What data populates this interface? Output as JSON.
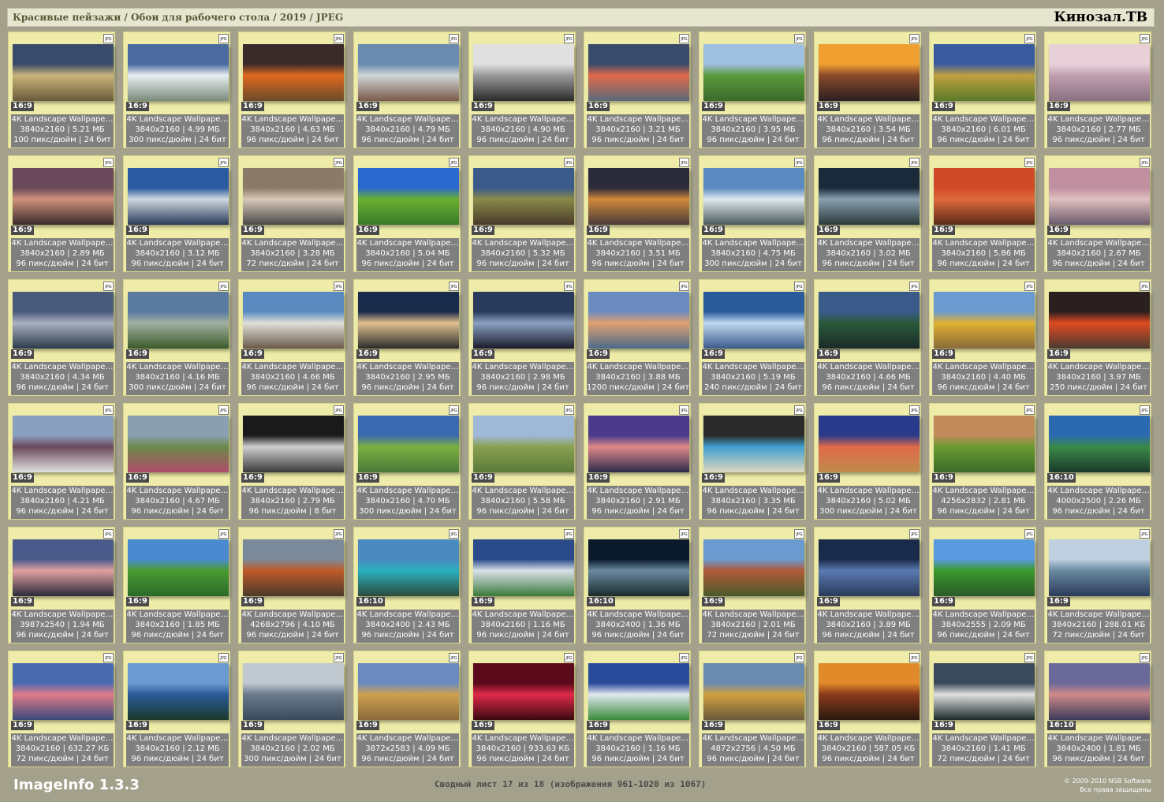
{
  "header": {
    "breadcrumb": "Красивые пейзажи / Обои для рабочего стола / 2019 / JPEG",
    "brand": "Кинозал.ТВ"
  },
  "footer": {
    "app_name": "ImageInfo 1.3.3",
    "summary": "Сводный лист 17 из 18 (изображения 961-1020 из 1067)",
    "copyright_line1": "© 2009-2010 NSB Software",
    "copyright_line2": "Все права защищены"
  },
  "file_badge": "JPG",
  "items": [
    {
      "title": "4K Landscape Wallpape…",
      "res": "3840x2160 | 5.21 МБ",
      "dpi": "100 пикс/дюйм | 24 бит",
      "ratio": "16:9",
      "colors": [
        "#3a4a6a",
        "#c9b47a",
        "#6a5a3a"
      ]
    },
    {
      "title": "4K Landscape Wallpape…",
      "res": "3840x2160 | 4.99 МБ",
      "dpi": "300 пикс/дюйм | 24 бит",
      "ratio": "16:9",
      "colors": [
        "#4a6aa0",
        "#e8eef2",
        "#7a8a7a"
      ]
    },
    {
      "title": "4K Landscape Wallpape…",
      "res": "3840x2160 | 4.63 МБ",
      "dpi": "96 пикс/дюйм | 24 бит",
      "ratio": "16:9",
      "colors": [
        "#3a2a2a",
        "#e06a20",
        "#6a4a2a"
      ]
    },
    {
      "title": "4K Landscape Wallpape…",
      "res": "3840x2160 | 4.79 МБ",
      "dpi": "96 пикс/дюйм | 24 бит",
      "ratio": "16:9",
      "colors": [
        "#6a8ab0",
        "#d0d6d8",
        "#7a5a4a"
      ]
    },
    {
      "title": "4K Landscape Wallpape…",
      "res": "3840x2160 | 4.90 МБ",
      "dpi": "96 пикс/дюйм | 24 бит",
      "ratio": "16:9",
      "colors": [
        "#e0e0e0",
        "#9a9a9a",
        "#2a2a2a"
      ]
    },
    {
      "title": "4K Landscape Wallpape…",
      "res": "3840x2160 | 3.21 МБ",
      "dpi": "96 пикс/дюйм | 24 бит",
      "ratio": "16:9",
      "colors": [
        "#3a4a6a",
        "#e06a4a",
        "#5a6a7a"
      ]
    },
    {
      "title": "4K Landscape Wallpape…",
      "res": "3840x2160 | 3.95 МБ",
      "dpi": "96 пикс/дюйм | 24 бит",
      "ratio": "16:9",
      "colors": [
        "#a0c0e0",
        "#5a9a3a",
        "#3a6a2a"
      ]
    },
    {
      "title": "4K Landscape Wallpape…",
      "res": "3840x2160 | 3.54 МБ",
      "dpi": "96 пикс/дюйм | 24 бит",
      "ratio": "16:9",
      "colors": [
        "#f0a030",
        "#8a4a2a",
        "#2a2020"
      ]
    },
    {
      "title": "4K Landscape Wallpape…",
      "res": "3840x2160 | 6.01 МБ",
      "dpi": "96 пикс/дюйм | 24 бит",
      "ratio": "16:9",
      "colors": [
        "#3a5aa0",
        "#c0a040",
        "#5a7a2a"
      ]
    },
    {
      "title": "4K Landscape Wallpape…",
      "res": "3840x2160 | 2.77 МБ",
      "dpi": "96 пикс/дюйм | 24 бит",
      "ratio": "16:9",
      "colors": [
        "#e8d0d8",
        "#c0a0b0",
        "#8a7080"
      ]
    },
    {
      "title": "4K Landscape Wallpape…",
      "res": "3840x2160 | 2.89 МБ",
      "dpi": "96 пикс/дюйм | 24 бит",
      "ratio": "16:9",
      "colors": [
        "#6a4a5a",
        "#d0907a",
        "#3a2a2a"
      ]
    },
    {
      "title": "4K Landscape Wallpape…",
      "res": "3840x2160 | 3.12 МБ",
      "dpi": "96 пикс/дюйм | 24 бит",
      "ratio": "16:9",
      "colors": [
        "#2a5aa0",
        "#d0d8e0",
        "#2a3a5a"
      ]
    },
    {
      "title": "4K Landscape Wallpape…",
      "res": "3840x2160 | 3.28 МБ",
      "dpi": "72 пикс/дюйм | 24 бит",
      "ratio": "16:9",
      "colors": [
        "#8a7a6a",
        "#d8c8b8",
        "#4a4a4a"
      ]
    },
    {
      "title": "4K Landscape Wallpape…",
      "res": "3840x2160 | 5.04 МБ",
      "dpi": "96 пикс/дюйм | 24 бит",
      "ratio": "16:9",
      "colors": [
        "#2a6ad0",
        "#6ab030",
        "#3a7a2a"
      ]
    },
    {
      "title": "4K Landscape Wallpape…",
      "res": "3840x2160 | 5.32 МБ",
      "dpi": "96 пикс/дюйм | 24 бит",
      "ratio": "16:9",
      "colors": [
        "#3a5a8a",
        "#8a8a4a",
        "#4a3a2a"
      ]
    },
    {
      "title": "4K Landscape Wallpape…",
      "res": "3840x2160 | 3.51 МБ",
      "dpi": "96 пикс/дюйм | 24 бит",
      "ratio": "16:9",
      "colors": [
        "#2a2a3a",
        "#d08a3a",
        "#4a3a3a"
      ]
    },
    {
      "title": "4K Landscape Wallpape…",
      "res": "3840x2160 | 4.75 МБ",
      "dpi": "300 пикс/дюйм | 24 бит",
      "ratio": "16:9",
      "colors": [
        "#5a8ac0",
        "#e0e8f0",
        "#4a5a5a"
      ]
    },
    {
      "title": "4K Landscape Wallpape…",
      "res": "3840x2160 | 3.02 МБ",
      "dpi": "96 пикс/дюйм | 24 бит",
      "ratio": "16:9",
      "colors": [
        "#1a2a3a",
        "#8aa0b0",
        "#2a3a3a"
      ]
    },
    {
      "title": "4K Landscape Wallpape…",
      "res": "3840x2160 | 5.86 МБ",
      "dpi": "96 пикс/дюйм | 24 бит",
      "ratio": "16:9",
      "colors": [
        "#d04a2a",
        "#e06a3a",
        "#5a2a1a"
      ]
    },
    {
      "title": "4K Landscape Wallpape…",
      "res": "3840x2160 | 2.67 МБ",
      "dpi": "96 пикс/дюйм | 24 бит",
      "ratio": "16:9",
      "colors": [
        "#c090a0",
        "#e0c0c0",
        "#6a5a6a"
      ]
    },
    {
      "title": "4K Landscape Wallpape…",
      "res": "3840x2160 | 4.34 МБ",
      "dpi": "96 пикс/дюйм | 24 бит",
      "ratio": "16:9",
      "colors": [
        "#4a5a7a",
        "#aab0c0",
        "#2a3a4a"
      ]
    },
    {
      "title": "4K Landscape Wallpape…",
      "res": "3840x2160 | 4.16 МБ",
      "dpi": "300 пикс/дюйм | 24 бит",
      "ratio": "16:9",
      "colors": [
        "#5a7aa0",
        "#a0b0a0",
        "#3a5a2a"
      ]
    },
    {
      "title": "4K Landscape Wallpape…",
      "res": "3840x2160 | 4.66 МБ",
      "dpi": "96 пикс/дюйм | 24 бит",
      "ratio": "16:9",
      "colors": [
        "#5a8ac0",
        "#e0e0d8",
        "#6a5a4a"
      ]
    },
    {
      "title": "4K Landscape Wallpape…",
      "res": "3840x2160 | 2.95 МБ",
      "dpi": "96 пикс/дюйм | 24 бит",
      "ratio": "16:9",
      "colors": [
        "#1a2a4a",
        "#e0c090",
        "#2a2a2a"
      ]
    },
    {
      "title": "4K Landscape Wallpape…",
      "res": "3840x2160 | 2.98 МБ",
      "dpi": "96 пикс/дюйм | 24 бит",
      "ratio": "16:9",
      "colors": [
        "#2a3a5a",
        "#8aa0c0",
        "#1a1a2a"
      ]
    },
    {
      "title": "4K Landscape Wallpape…",
      "res": "3840x2160 | 3.88 МБ",
      "dpi": "1200 пикс/дюйм | 24 бит",
      "ratio": "16:9",
      "colors": [
        "#6a8ac0",
        "#e0a070",
        "#4a6a8a"
      ]
    },
    {
      "title": "4K Landscape Wallpape…",
      "res": "3840x2160 | 5.19 МБ",
      "dpi": "240 пикс/дюйм | 24 бит",
      "ratio": "16:9",
      "colors": [
        "#2a5a9a",
        "#c0d8f0",
        "#3a5a8a"
      ]
    },
    {
      "title": "4K Landscape Wallpape…",
      "res": "3840x2160 | 4.66 МБ",
      "dpi": "96 пикс/дюйм | 24 бит",
      "ratio": "16:9",
      "colors": [
        "#3a5a8a",
        "#2a5a3a",
        "#1a2a2a"
      ]
    },
    {
      "title": "4K Landscape Wallpape…",
      "res": "3840x2160 | 4.40 МБ",
      "dpi": "96 пикс/дюйм | 24 бит",
      "ratio": "16:9",
      "colors": [
        "#6a9ad0",
        "#e0b030",
        "#8a6a3a"
      ]
    },
    {
      "title": "4K Landscape Wallpape…",
      "res": "3840x2160 | 3.97 МБ",
      "dpi": "250 пикс/дюйм | 24 бит",
      "ratio": "16:9",
      "colors": [
        "#2a2020",
        "#e04a20",
        "#4a3a30"
      ]
    },
    {
      "title": "4K Landscape Wallpape…",
      "res": "3840x2160 | 4.21 МБ",
      "dpi": "96 пикс/дюйм | 24 бит",
      "ratio": "16:9",
      "colors": [
        "#8aa0c0",
        "#6a4a5a",
        "#e0e0e0"
      ]
    },
    {
      "title": "4K Landscape Wallpape…",
      "res": "3840x2160 | 4.67 МБ",
      "dpi": "96 пикс/дюйм | 24 бит",
      "ratio": "16:9",
      "colors": [
        "#8aa0b0",
        "#6a8a4a",
        "#b04a6a"
      ]
    },
    {
      "title": "4K Landscape Wallpape…",
      "res": "3840x2160 | 2.79 МБ",
      "dpi": "96 пикс/дюйм | 8 бит",
      "ratio": "16:9",
      "colors": [
        "#1a1a1a",
        "#d0d0d0",
        "#3a3a3a"
      ]
    },
    {
      "title": "4K Landscape Wallpape…",
      "res": "3840x2160 | 4.70 МБ",
      "dpi": "300 пикс/дюйм | 24 бит",
      "ratio": "16:9",
      "colors": [
        "#3a6ab0",
        "#7ab040",
        "#4a7a3a"
      ]
    },
    {
      "title": "4K Landscape Wallpape…",
      "res": "3840x2160 | 5.58 МБ",
      "dpi": "96 пикс/дюйм | 24 бит",
      "ratio": "16:9",
      "colors": [
        "#a0b8d8",
        "#8aa050",
        "#5a7a3a"
      ]
    },
    {
      "title": "4K Landscape Wallpape…",
      "res": "3840x2160 | 2.91 МБ",
      "dpi": "96 пикс/дюйм | 24 бит",
      "ratio": "16:9",
      "colors": [
        "#4a3a8a",
        "#e08a8a",
        "#2a2a4a"
      ]
    },
    {
      "title": "4K Landscape Wallpape…",
      "res": "3840x2160 | 3.35 МБ",
      "dpi": "96 пикс/дюйм | 24 бит",
      "ratio": "16:9",
      "colors": [
        "#2a2a2a",
        "#40a0d0",
        "#e0d8c0"
      ]
    },
    {
      "title": "4K Landscape Wallpape…",
      "res": "3840x2160 | 5.02 МБ",
      "dpi": "300 пикс/дюйм | 24 бит",
      "ratio": "16:9",
      "colors": [
        "#2a3a8a",
        "#e06a4a",
        "#c08a4a"
      ]
    },
    {
      "title": "4K Landscape Wallpape…",
      "res": "4256x2832 | 2.81 МБ",
      "dpi": "96 пикс/дюйм | 24 бит",
      "ratio": "16:9",
      "colors": [
        "#c08a5a",
        "#6a9a30",
        "#3a6a2a"
      ]
    },
    {
      "title": "4K Landscape Wallpape…",
      "res": "4000x2500 | 2.26 МБ",
      "dpi": "96 пикс/дюйм | 24 бит",
      "ratio": "16:10",
      "colors": [
        "#2a6ab0",
        "#3a8a4a",
        "#1a3a2a"
      ]
    },
    {
      "title": "4K Landscape Wallpape…",
      "res": "3987x2540 | 1.94 МБ",
      "dpi": "96 пикс/дюйм | 24 бит",
      "ratio": "16:9",
      "colors": [
        "#4a5a8a",
        "#e0a0a0",
        "#2a2a3a"
      ]
    },
    {
      "title": "4K Landscape Wallpape…",
      "res": "3840x2160 | 1.85 МБ",
      "dpi": "96 пикс/дюйм | 24 бит",
      "ratio": "16:9",
      "colors": [
        "#4a8ad0",
        "#4a9a30",
        "#2a6a2a"
      ]
    },
    {
      "title": "4K Landscape Wallpape…",
      "res": "4268x2796 | 4.10 МБ",
      "dpi": "96 пикс/дюйм | 24 бит",
      "ratio": "16:9",
      "colors": [
        "#7a8a9a",
        "#c05a2a",
        "#4a3a2a"
      ]
    },
    {
      "title": "4K Landscape Wallpape…",
      "res": "3840x2400 | 2.43 МБ",
      "dpi": "96 пикс/дюйм | 24 бит",
      "ratio": "16:10",
      "colors": [
        "#4a8ac0",
        "#2ab0c0",
        "#2a4a3a"
      ]
    },
    {
      "title": "4K Landscape Wallpape…",
      "res": "3840x2160 | 1.16 МБ",
      "dpi": "96 пикс/дюйм | 24 бит",
      "ratio": "16:9",
      "colors": [
        "#2a4a8a",
        "#d8e0e8",
        "#3a7a3a"
      ]
    },
    {
      "title": "4K Landscape Wallpape…",
      "res": "3840x2400 | 1.36 МБ",
      "dpi": "96 пикс/дюйм | 24 бит",
      "ratio": "16:10",
      "colors": [
        "#0a1a2a",
        "#6a8aa0",
        "#1a2a2a"
      ]
    },
    {
      "title": "4K Landscape Wallpape…",
      "res": "3840x2160 | 2.01 МБ",
      "dpi": "72 пикс/дюйм | 24 бит",
      "ratio": "16:9",
      "colors": [
        "#6a9ad0",
        "#b05a3a",
        "#4a5a2a"
      ]
    },
    {
      "title": "4K Landscape Wallpape…",
      "res": "3840x2160 | 3.89 МБ",
      "dpi": "96 пикс/дюйм | 24 бит",
      "ratio": "16:9",
      "colors": [
        "#1a2a4a",
        "#5a7ab0",
        "#2a3a5a"
      ]
    },
    {
      "title": "4K Landscape Wallpape…",
      "res": "3840x2555 | 2.09 МБ",
      "dpi": "96 пикс/дюйм | 24 бит",
      "ratio": "16:9",
      "colors": [
        "#5a9ae0",
        "#3a9a2a",
        "#2a5a2a"
      ]
    },
    {
      "title": "4K Landscape Wallpape…",
      "res": "3840x2160 | 288.01 КБ",
      "dpi": "72 пикс/дюйм | 24 бит",
      "ratio": "16:9",
      "colors": [
        "#c0d0e0",
        "#6a8aa0",
        "#2a3a5a"
      ]
    },
    {
      "title": "4K Landscape Wallpape…",
      "res": "3840x2160 | 632.27 КБ",
      "dpi": "72 пикс/дюйм | 24 бит",
      "ratio": "16:9",
      "colors": [
        "#4a6ab0",
        "#e07a8a",
        "#3a4a7a"
      ]
    },
    {
      "title": "4K Landscape Wallpape…",
      "res": "3840x2160 | 2.12 МБ",
      "dpi": "96 пикс/дюйм | 24 бит",
      "ratio": "16:9",
      "colors": [
        "#6a9ad0",
        "#2a5a9a",
        "#1a3a2a"
      ]
    },
    {
      "title": "4K Landscape Wallpape…",
      "res": "3840x2160 | 2.02 МБ",
      "dpi": "300 пикс/дюйм | 24 бит",
      "ratio": "16:9",
      "colors": [
        "#c0c8d0",
        "#6a7a8a",
        "#3a4a5a"
      ]
    },
    {
      "title": "4K Landscape Wallpape…",
      "res": "3872x2583 | 4.09 МБ",
      "dpi": "96 пикс/дюйм | 24 бит",
      "ratio": "16:9",
      "colors": [
        "#6a8ac0",
        "#d0a050",
        "#8a6a3a"
      ]
    },
    {
      "title": "4K Landscape Wallpape…",
      "res": "3840x2160 | 933.63 КБ",
      "dpi": "96 пикс/дюйм | 24 бит",
      "ratio": "16:9",
      "colors": [
        "#5a0a1a",
        "#e02a4a",
        "#3a0a10"
      ]
    },
    {
      "title": "4K Landscape Wallpape…",
      "res": "3840x2160 | 1.16 МБ",
      "dpi": "96 пикс/дюйм | 24 бит",
      "ratio": "16:9",
      "colors": [
        "#2a4a9a",
        "#e0e8f0",
        "#3a8a3a"
      ]
    },
    {
      "title": "4K Landscape Wallpape…",
      "res": "4872x2756 | 4.50 МБ",
      "dpi": "96 пикс/дюйм | 24 бит",
      "ratio": "16:9",
      "colors": [
        "#6a8ab0",
        "#d0a040",
        "#6a5a3a"
      ]
    },
    {
      "title": "4K Landscape Wallpape…",
      "res": "3840x2160 | 587.05 КБ",
      "dpi": "96 пикс/дюйм | 24 бит",
      "ratio": "16:9",
      "colors": [
        "#e08a2a",
        "#8a3a1a",
        "#2a1a10"
      ]
    },
    {
      "title": "4K Landscape Wallpape…",
      "res": "3840x2160 | 1.41 МБ",
      "dpi": "72 пикс/дюйм | 24 бит",
      "ratio": "16:9",
      "colors": [
        "#3a4a5a",
        "#e0e0e0",
        "#1a2a2a"
      ]
    },
    {
      "title": "4K Landscape Wallpape…",
      "res": "3840x2400 | 1.81 МБ",
      "dpi": "96 пикс/дюйм | 24 бит",
      "ratio": "16:10",
      "colors": [
        "#6a6a9a",
        "#d08a8a",
        "#3a3a5a"
      ]
    }
  ]
}
